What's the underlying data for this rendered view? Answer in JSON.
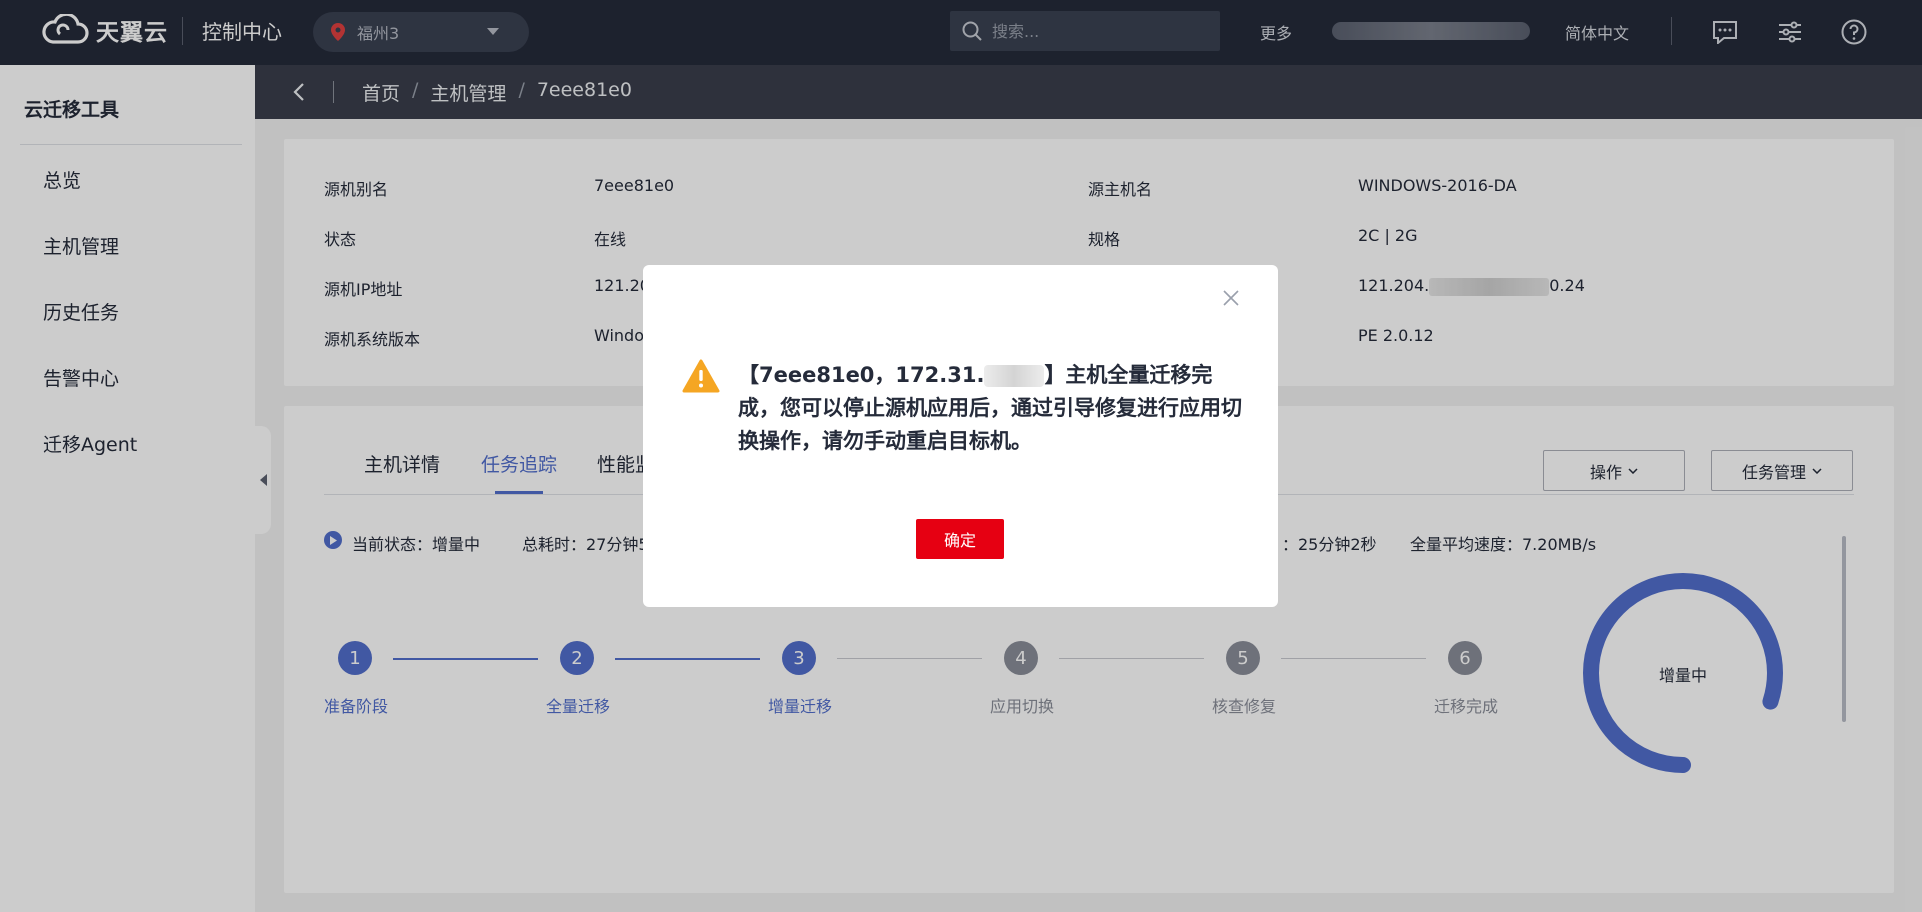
{
  "topbar": {
    "logo_text": "天翼云",
    "console_title": "控制中心",
    "region": "福州3",
    "search_placeholder": "搜索...",
    "more_label": "更多",
    "language": "简体中文",
    "icons": [
      "message-icon",
      "settings-sliders-icon",
      "help-icon"
    ]
  },
  "sidebar": {
    "title": "云迁移工具",
    "items": [
      {
        "label": "总览"
      },
      {
        "label": "主机管理"
      },
      {
        "label": "历史任务"
      },
      {
        "label": "告警中心"
      },
      {
        "label": "迁移Agent"
      }
    ]
  },
  "breadcrumb": [
    "首页",
    "主机管理",
    "7eee81e0"
  ],
  "host_info": {
    "alias_label": "源机别名",
    "alias_value": "7eee81e0",
    "status_label": "状态",
    "status_value": "在线",
    "ip_label": "源机IP地址",
    "ip_value_prefix": "121.20",
    "os_label": "源机系统版本",
    "os_value_prefix": "Windo",
    "hostname_label": "源主机名",
    "hostname_value": "WINDOWS-2016-DA",
    "spec_label": "规格",
    "spec_value": "2C | 2G",
    "ip2_prefix": "121.204.",
    "ip2_suffix": "0.24",
    "version_value": "PE 2.0.12"
  },
  "tabs": [
    {
      "label": "主机详情",
      "active": false
    },
    {
      "label": "任务追踪",
      "active": true
    },
    {
      "label": "性能监",
      "active": false
    }
  ],
  "actions": {
    "operate": "操作",
    "task_manage": "任务管理"
  },
  "status": {
    "current": "当前状态：增量中",
    "total_time": "总耗时：27分钟5",
    "elapsed_tail": "：25分钟2秒",
    "avg_speed": "全量平均速度：7.20MB/s"
  },
  "steps": [
    {
      "num": "1",
      "label": "准备阶段",
      "done": true
    },
    {
      "num": "2",
      "label": "全量迁移",
      "done": true
    },
    {
      "num": "3",
      "label": "增量迁移",
      "done": true
    },
    {
      "num": "4",
      "label": "应用切换",
      "done": false
    },
    {
      "num": "5",
      "label": "核查修复",
      "done": false
    },
    {
      "num": "6",
      "label": "迁移完成",
      "done": false
    }
  ],
  "ring": {
    "label": "增量中",
    "progress": 0.8,
    "color": "#526ecc"
  },
  "modal": {
    "text_part1": "【7eee81e0，172.31.",
    "text_part2": "】主机全量迁移完成，您可以停止源机应用后，通过引导修复进行应用切换操作，请勿手动重启目标机。",
    "ok_label": "确定"
  },
  "colors": {
    "accent": "#526ecc",
    "danger": "#e60012",
    "topbar": "#252b3a",
    "warning": "#f5a623"
  }
}
